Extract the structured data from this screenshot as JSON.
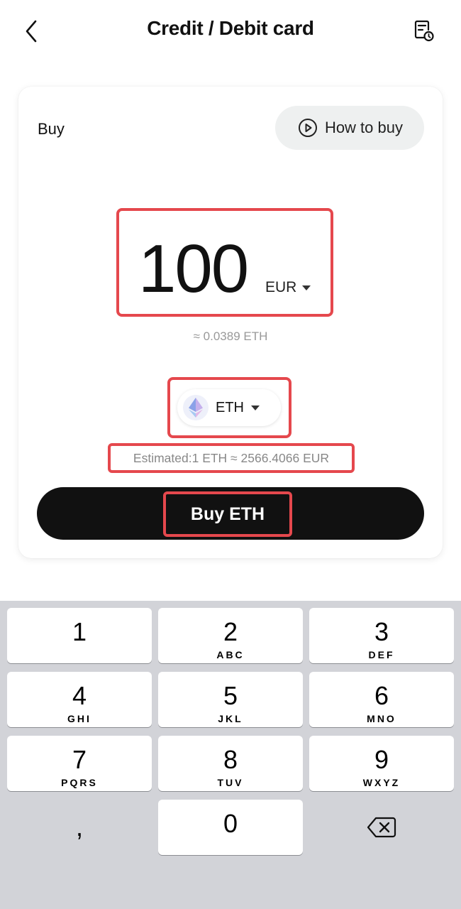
{
  "header": {
    "title": "Credit / Debit card"
  },
  "card": {
    "buy_label": "Buy",
    "how_to_buy": "How to buy",
    "amount": "100",
    "currency": "EUR",
    "approx": "≈ 0.0389 ETH",
    "token": "ETH",
    "estimate": "Estimated:1 ETH ≈ 2566.4066 EUR",
    "buy_button": "Buy ETH"
  },
  "keypad": {
    "keys": [
      {
        "num": "1",
        "letters": ""
      },
      {
        "num": "2",
        "letters": "ABC"
      },
      {
        "num": "3",
        "letters": "DEF"
      },
      {
        "num": "4",
        "letters": "GHI"
      },
      {
        "num": "5",
        "letters": "JKL"
      },
      {
        "num": "6",
        "letters": "MNO"
      },
      {
        "num": "7",
        "letters": "PQRS"
      },
      {
        "num": "8",
        "letters": "TUV"
      },
      {
        "num": "9",
        "letters": "WXYZ"
      },
      {
        "num": "0",
        "letters": ""
      }
    ],
    "decimal": ","
  },
  "colors": {
    "highlight": "#e5484d",
    "buy_button": "#111111",
    "keyboard_bg": "#d2d3d8"
  },
  "icons": [
    "chevron-left-icon",
    "history-icon",
    "play-circle-icon",
    "eth-logo-icon",
    "caret-down-icon",
    "backspace-icon"
  ]
}
